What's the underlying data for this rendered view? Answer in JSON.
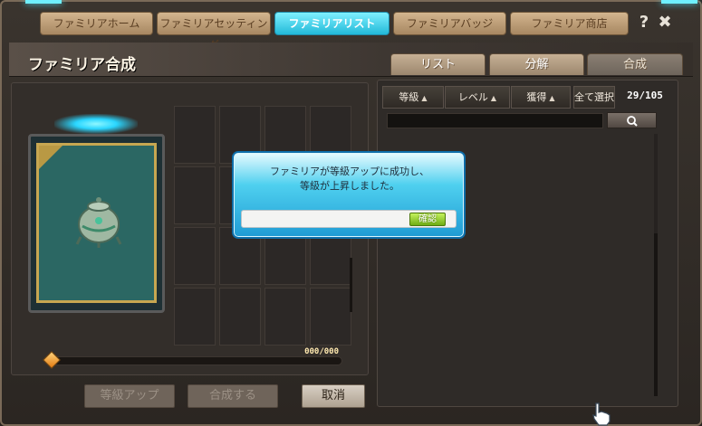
{
  "top_tabs": [
    {
      "label": "ファミリアホーム"
    },
    {
      "label": "ファミリアセッティング"
    },
    {
      "label": "ファミリアリスト",
      "active": true
    },
    {
      "label": "ファミリアバッジ"
    },
    {
      "label": "ファミリア商店"
    }
  ],
  "window_controls": {
    "help_icon": "?",
    "close_icon": "✖"
  },
  "page": {
    "title": "ファミリア合成"
  },
  "sub_tabs": [
    {
      "label": "リスト"
    },
    {
      "label": "分解"
    },
    {
      "label": "合成",
      "active": true
    }
  ],
  "synthesis": {
    "card_icon": "pot-familiar-icon",
    "experience_text": "000/000",
    "experience_fraction": 0,
    "buttons": {
      "grade_up": "等級アップ",
      "synthesize": "合成する",
      "cancel": "取消"
    }
  },
  "list_panel": {
    "sort_buttons": [
      {
        "label": "等級",
        "arrow": "▲"
      },
      {
        "label": "レベル",
        "arrow": "▲"
      },
      {
        "label": "獲得",
        "arrow": "▲"
      }
    ],
    "select_all_label": "全て選択",
    "count": "29/105",
    "search": {
      "value": "",
      "placeholder": ""
    },
    "search_icon": "magnifier-icon"
  },
  "dialog": {
    "message_line1": "ファミリアが等級アップに成功し、",
    "message_line2": "等級が上昇しました。",
    "confirm_label": "確認"
  },
  "colors": {
    "active_tab": "#22b9d8",
    "dialog_blue": "#1f9bd4",
    "confirm_green": "#6fae14",
    "card_gold": "#c7a751"
  }
}
